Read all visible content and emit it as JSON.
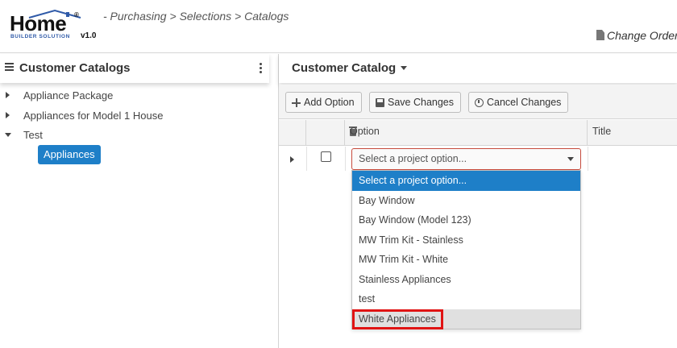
{
  "logo": {
    "word": "Home",
    "registered": "®",
    "subtitle": "BUILDER SOLUTION",
    "version": "v1.0",
    "house_icon": "house-roof-icon"
  },
  "breadcrumb": [
    "- Purchasing",
    " > ",
    "Selections",
    " > ",
    "Catalogs"
  ],
  "header": {
    "change_order_label": "Change Order",
    "change_order_icon": "document-icon"
  },
  "left_panel": {
    "title": "Customer Catalogs",
    "menu_icon": "hamburger-icon",
    "options_icon": "kebab-icon",
    "tree": [
      {
        "label": "Appliance Package",
        "expanded": false
      },
      {
        "label": "Appliances for Model 1 House",
        "expanded": false
      },
      {
        "label": "Test",
        "expanded": true,
        "children": [
          {
            "label": "Appliances",
            "selected": true
          }
        ]
      }
    ]
  },
  "right_panel": {
    "title": "Customer Catalog",
    "toolbar": {
      "add_option": "Add Option",
      "save_changes": "Save Changes",
      "cancel_changes": "Cancel Changes"
    },
    "columns": [
      "Option",
      "Title"
    ],
    "row": {
      "select_value": "Select a project option..."
    },
    "dropdown_options": [
      "Select a project option...",
      "Bay Window",
      "Bay Window (Model 123)",
      "MW Trim Kit - Stainless",
      "MW Trim Kit - White",
      "Stainless Appliances",
      "test",
      "White Appliances"
    ],
    "dropdown_selected_index": 0,
    "dropdown_highlighted_index": 7
  },
  "colors": {
    "accent_blue": "#1e7fc8",
    "select_border": "#c64a3c",
    "highlight_red": "#e01414"
  }
}
